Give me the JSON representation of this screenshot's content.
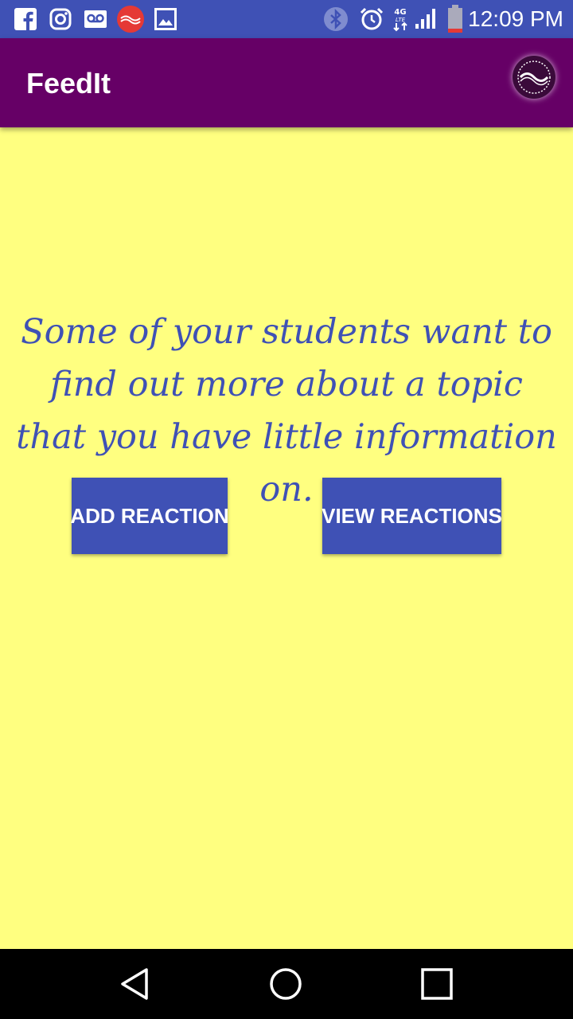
{
  "status_bar": {
    "time": "12:09 PM",
    "network": "4G",
    "icons": [
      "facebook-icon",
      "instagram-icon",
      "voicemail-icon",
      "app-notification-icon",
      "image-icon",
      "bluetooth-icon",
      "alarm-icon",
      "lte-data-icon",
      "signal-icon",
      "battery-icon"
    ],
    "color": "#3f51b5"
  },
  "app_bar": {
    "title": "FeedIt",
    "color": "#660066"
  },
  "main": {
    "prompt": "Some of your students want to find out more about a topic that you have little information on.",
    "background": "#ffff80",
    "text_color": "#3f51b5",
    "add_button_label": "ADD REACTION",
    "view_button_label": "VIEW REACTIONS",
    "button_color": "#3f51b5"
  },
  "nav_bar": {
    "icons": [
      "back-icon",
      "home-icon",
      "recents-icon"
    ]
  }
}
